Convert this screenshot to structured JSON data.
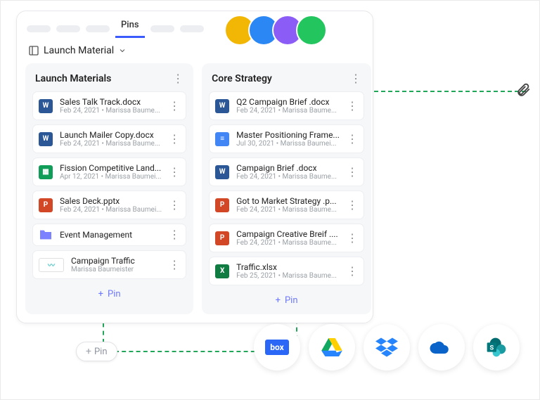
{
  "tabs": {
    "active": "Pins"
  },
  "breadcrumb": {
    "title": "Launch Material"
  },
  "columns": [
    {
      "title": "Launch Materials",
      "items": [
        {
          "icon": "word",
          "name": "Sales Talk Track.docx",
          "sub": "Feb 24, 2021 • Marissa Baume..."
        },
        {
          "icon": "word",
          "name": "Launch Mailer Copy.docx",
          "sub": "Feb 24, 2021 • Marissa Baume..."
        },
        {
          "icon": "sheets",
          "name": "Fission Competitive Land...",
          "sub": "Apr 12, 2021 • Marissa Baumei..."
        },
        {
          "icon": "ppt",
          "name": "Sales Deck.pptx",
          "sub": "Feb 24, 2021 • Marissa Baumei..."
        },
        {
          "icon": "folder",
          "name": "Event Management",
          "sub": ""
        },
        {
          "icon": "chart",
          "name": "Campaign Traffic",
          "sub": "Marissa Baumeister"
        }
      ],
      "pin": "Pin"
    },
    {
      "title": "Core Strategy",
      "items": [
        {
          "icon": "word",
          "name": "Q2 Campaign Brief .docx",
          "sub": "Feb 24, 2021 • Marissa Baume..."
        },
        {
          "icon": "docs",
          "name": "Master Positioning Frame...",
          "sub": "Jul 30, 2021 • Marissa Baumei..."
        },
        {
          "icon": "word",
          "name": "Campaign Brief .docx",
          "sub": "Feb 24, 2021 • Marissa Baume..."
        },
        {
          "icon": "ppt",
          "name": "Got to Market Strategy .p...",
          "sub": "Feb 24, 2021 • Marissa Baume..."
        },
        {
          "icon": "ppt",
          "name": "Campaign Creative Breif ....",
          "sub": "Feb 24, 2021 • Marissa Baume..."
        },
        {
          "icon": "xls",
          "name": "Traffic.xlsx",
          "sub": "Feb 25, 2021 • Marissa Baume..."
        }
      ],
      "pin": "Pin"
    }
  ],
  "ext_pin": "Pin",
  "services": [
    "box",
    "gdrive",
    "dropbox",
    "onedrive",
    "sharepoint"
  ],
  "colors": {
    "accent": "#3b5bfd",
    "dash": "#22a65a"
  }
}
